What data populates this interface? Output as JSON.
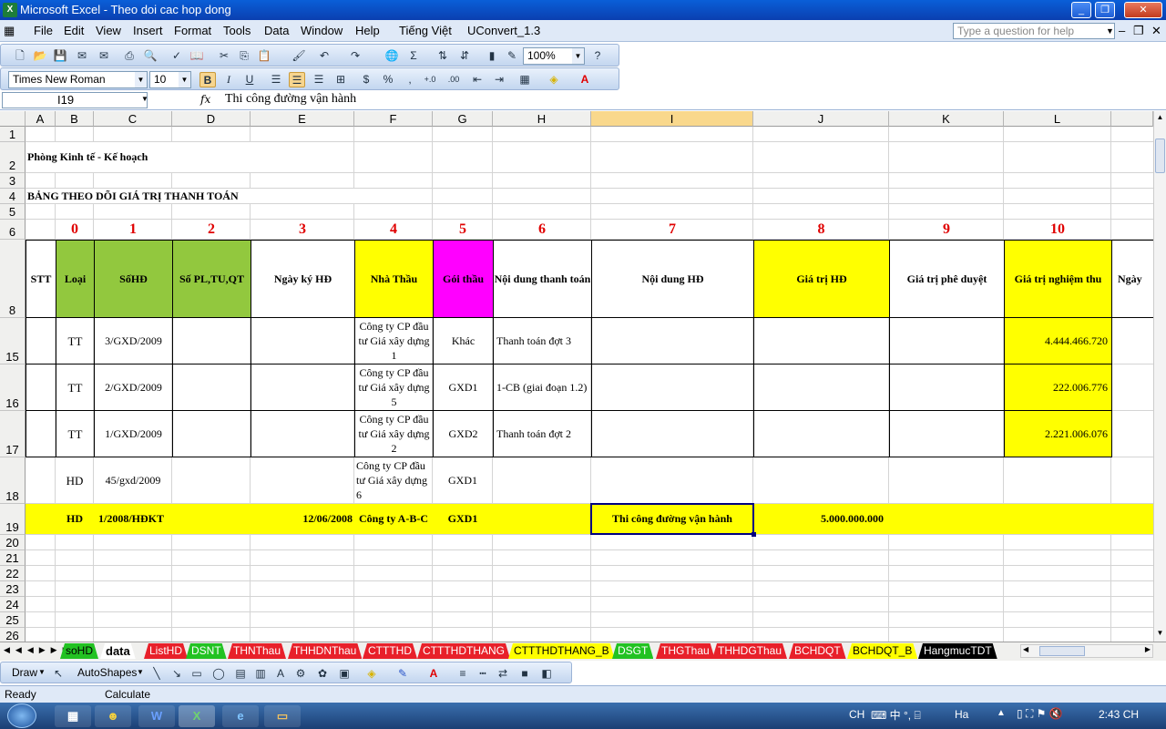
{
  "window": {
    "title": "Microsoft Excel - Theo doi cac hop dong"
  },
  "menu": [
    "File",
    "Edit",
    "View",
    "Insert",
    "Format",
    "Tools",
    "Data",
    "Window",
    "Help",
    "Tiếng Việt",
    "UConvert_1.3"
  ],
  "help_placeholder": "Type a question for help",
  "toolbar": {
    "zoom": "100%",
    "font": "Times New Roman",
    "font_size": "10"
  },
  "formula": {
    "cell_ref": "I19",
    "fx": "fx",
    "content": "Thi công đường vận hành"
  },
  "columns": [
    "A",
    "B",
    "C",
    "D",
    "E",
    "F",
    "G",
    "H",
    "I",
    "J",
    "K",
    "L"
  ],
  "rows": [
    "1",
    "2",
    "3",
    "4",
    "5",
    "6",
    "8",
    "15",
    "16",
    "17",
    "18",
    "19",
    "20",
    "21",
    "22",
    "23",
    "24",
    "25",
    "26"
  ],
  "sheet": {
    "r2_title": "Phòng Kinh tế - Kế hoạch",
    "r4_title": "BẢNG THEO DÕI GIÁ TRỊ THANH TOÁN",
    "index_numbers": [
      "0",
      "1",
      "2",
      "3",
      "4",
      "5",
      "6",
      "7",
      "8",
      "9",
      "10"
    ],
    "headers": [
      "STT",
      "Loại",
      "SốHĐ",
      "Số PL,TU,QT",
      "Ngày ký HĐ",
      "Nhà Thầu",
      "Gói thầu",
      "Nội dung thanh toán",
      "Nội dung HĐ",
      "Giá trị HĐ",
      "Giá trị phê duyệt",
      "Giá trị nghiệm thu",
      "Ngày"
    ],
    "data_rows": [
      {
        "loai": "TT",
        "sohd": "3/GXD/2009",
        "nhathau": "Công ty CP đầu tư Giá xây dựng 1",
        "goithau": "Khác",
        "noidung_tt": "Thanh toán đợt 3",
        "gt_nt": "4.444.466.720"
      },
      {
        "loai": "TT",
        "sohd": "2/GXD/2009",
        "nhathau": "Công ty CP đầu tư Giá xây dựng 5",
        "goithau": "GXD1",
        "noidung_tt": "1-CB (giai đoạn 1.2)",
        "gt_nt": "222.006.776"
      },
      {
        "loai": "TT",
        "sohd": "1/GXD/2009",
        "nhathau": "Công ty CP đầu tư Giá xây dựng 2",
        "goithau": "GXD2",
        "noidung_tt": "Thanh toán đợt 2",
        "gt_nt": "2.221.006.076"
      },
      {
        "loai": "HD",
        "sohd": "45/gxd/2009",
        "nhathau": "Công ty CP đầu tư Giá xây dựng 6",
        "goithau": "GXD1",
        "noidung_tt": "",
        "gt_nt": ""
      }
    ],
    "row19": {
      "loai": "HD",
      "sohd": "1/2008/HĐKT",
      "ngay": "12/06/2008",
      "nhathau": "Công ty A-B-C",
      "goithau": "GXD1",
      "noidung_hd": "Thi công đường vận hành",
      "gt_hd": "5.000.000.000"
    }
  },
  "sheet_tabs": [
    {
      "name": "soHD",
      "color": "#22c222"
    },
    {
      "name": "data",
      "color": "#ffffff"
    },
    {
      "name": "ListHD",
      "color": "#e8202a"
    },
    {
      "name": "DSNT",
      "color": "#22c222"
    },
    {
      "name": "THNThau",
      "color": "#e8202a"
    },
    {
      "name": "THHDNThau",
      "color": "#e8202a"
    },
    {
      "name": "CTTTHD",
      "color": "#e8202a"
    },
    {
      "name": "CTTTHDTHANG",
      "color": "#e8202a"
    },
    {
      "name": "CTTTHDTHANG_B",
      "color": "#ffff00"
    },
    {
      "name": "DSGT",
      "color": "#22c222"
    },
    {
      "name": "THGThau",
      "color": "#e8202a"
    },
    {
      "name": "THHDGThau",
      "color": "#e8202a"
    },
    {
      "name": "BCHDQT",
      "color": "#e8202a"
    },
    {
      "name": "BCHDQT_B",
      "color": "#ffff00"
    },
    {
      "name": "HangmucTDT",
      "color": "#000000"
    }
  ],
  "drawbar": {
    "draw": "Draw",
    "autoshapes": "AutoShapes"
  },
  "status": {
    "left": "Ready",
    "mid": "Calculate"
  },
  "taskbar": {
    "lang": "CH",
    "ime": "Ha",
    "time": "2:43 CH"
  },
  "colors": {
    "green": "#92c83e",
    "yellow": "#ffff00",
    "magenta": "#ff00ff",
    "red_index": "#e00000"
  }
}
